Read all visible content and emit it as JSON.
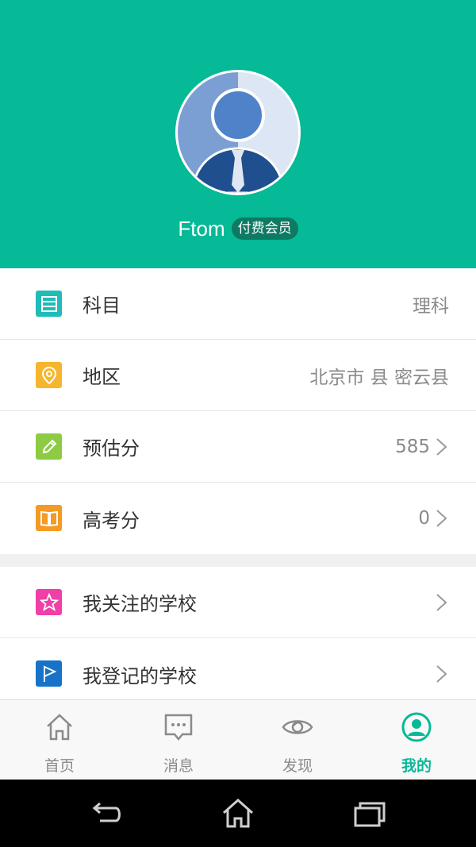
{
  "profile": {
    "name": "Ftom",
    "badge": "付费会员"
  },
  "info_rows": [
    {
      "label": "科目",
      "value": "理科",
      "icon": "grid-icon",
      "color": "#1fbcb8"
    },
    {
      "label": "地区",
      "value": "北京市 县 密云县",
      "icon": "location-pin-icon",
      "color": "#f5b52e"
    },
    {
      "label": "预估分",
      "value": "585",
      "icon": "pencil-icon",
      "color": "#8dcb45"
    },
    {
      "label": "高考分",
      "value": "0",
      "icon": "book-icon",
      "color": "#f59a23"
    }
  ],
  "school_rows": [
    {
      "label": "我关注的学校",
      "icon": "star-icon",
      "color": "#f03fa8"
    },
    {
      "label": "我登记的学校",
      "icon": "flag-icon",
      "color": "#1673c7"
    }
  ],
  "tabs": [
    {
      "label": "首页",
      "icon": "home-icon"
    },
    {
      "label": "消息",
      "icon": "message-icon"
    },
    {
      "label": "发现",
      "icon": "eye-icon"
    },
    {
      "label": "我的",
      "icon": "profile-icon",
      "active": true
    }
  ],
  "colors": {
    "accent": "#06b997",
    "badge": "#0d7a63"
  }
}
